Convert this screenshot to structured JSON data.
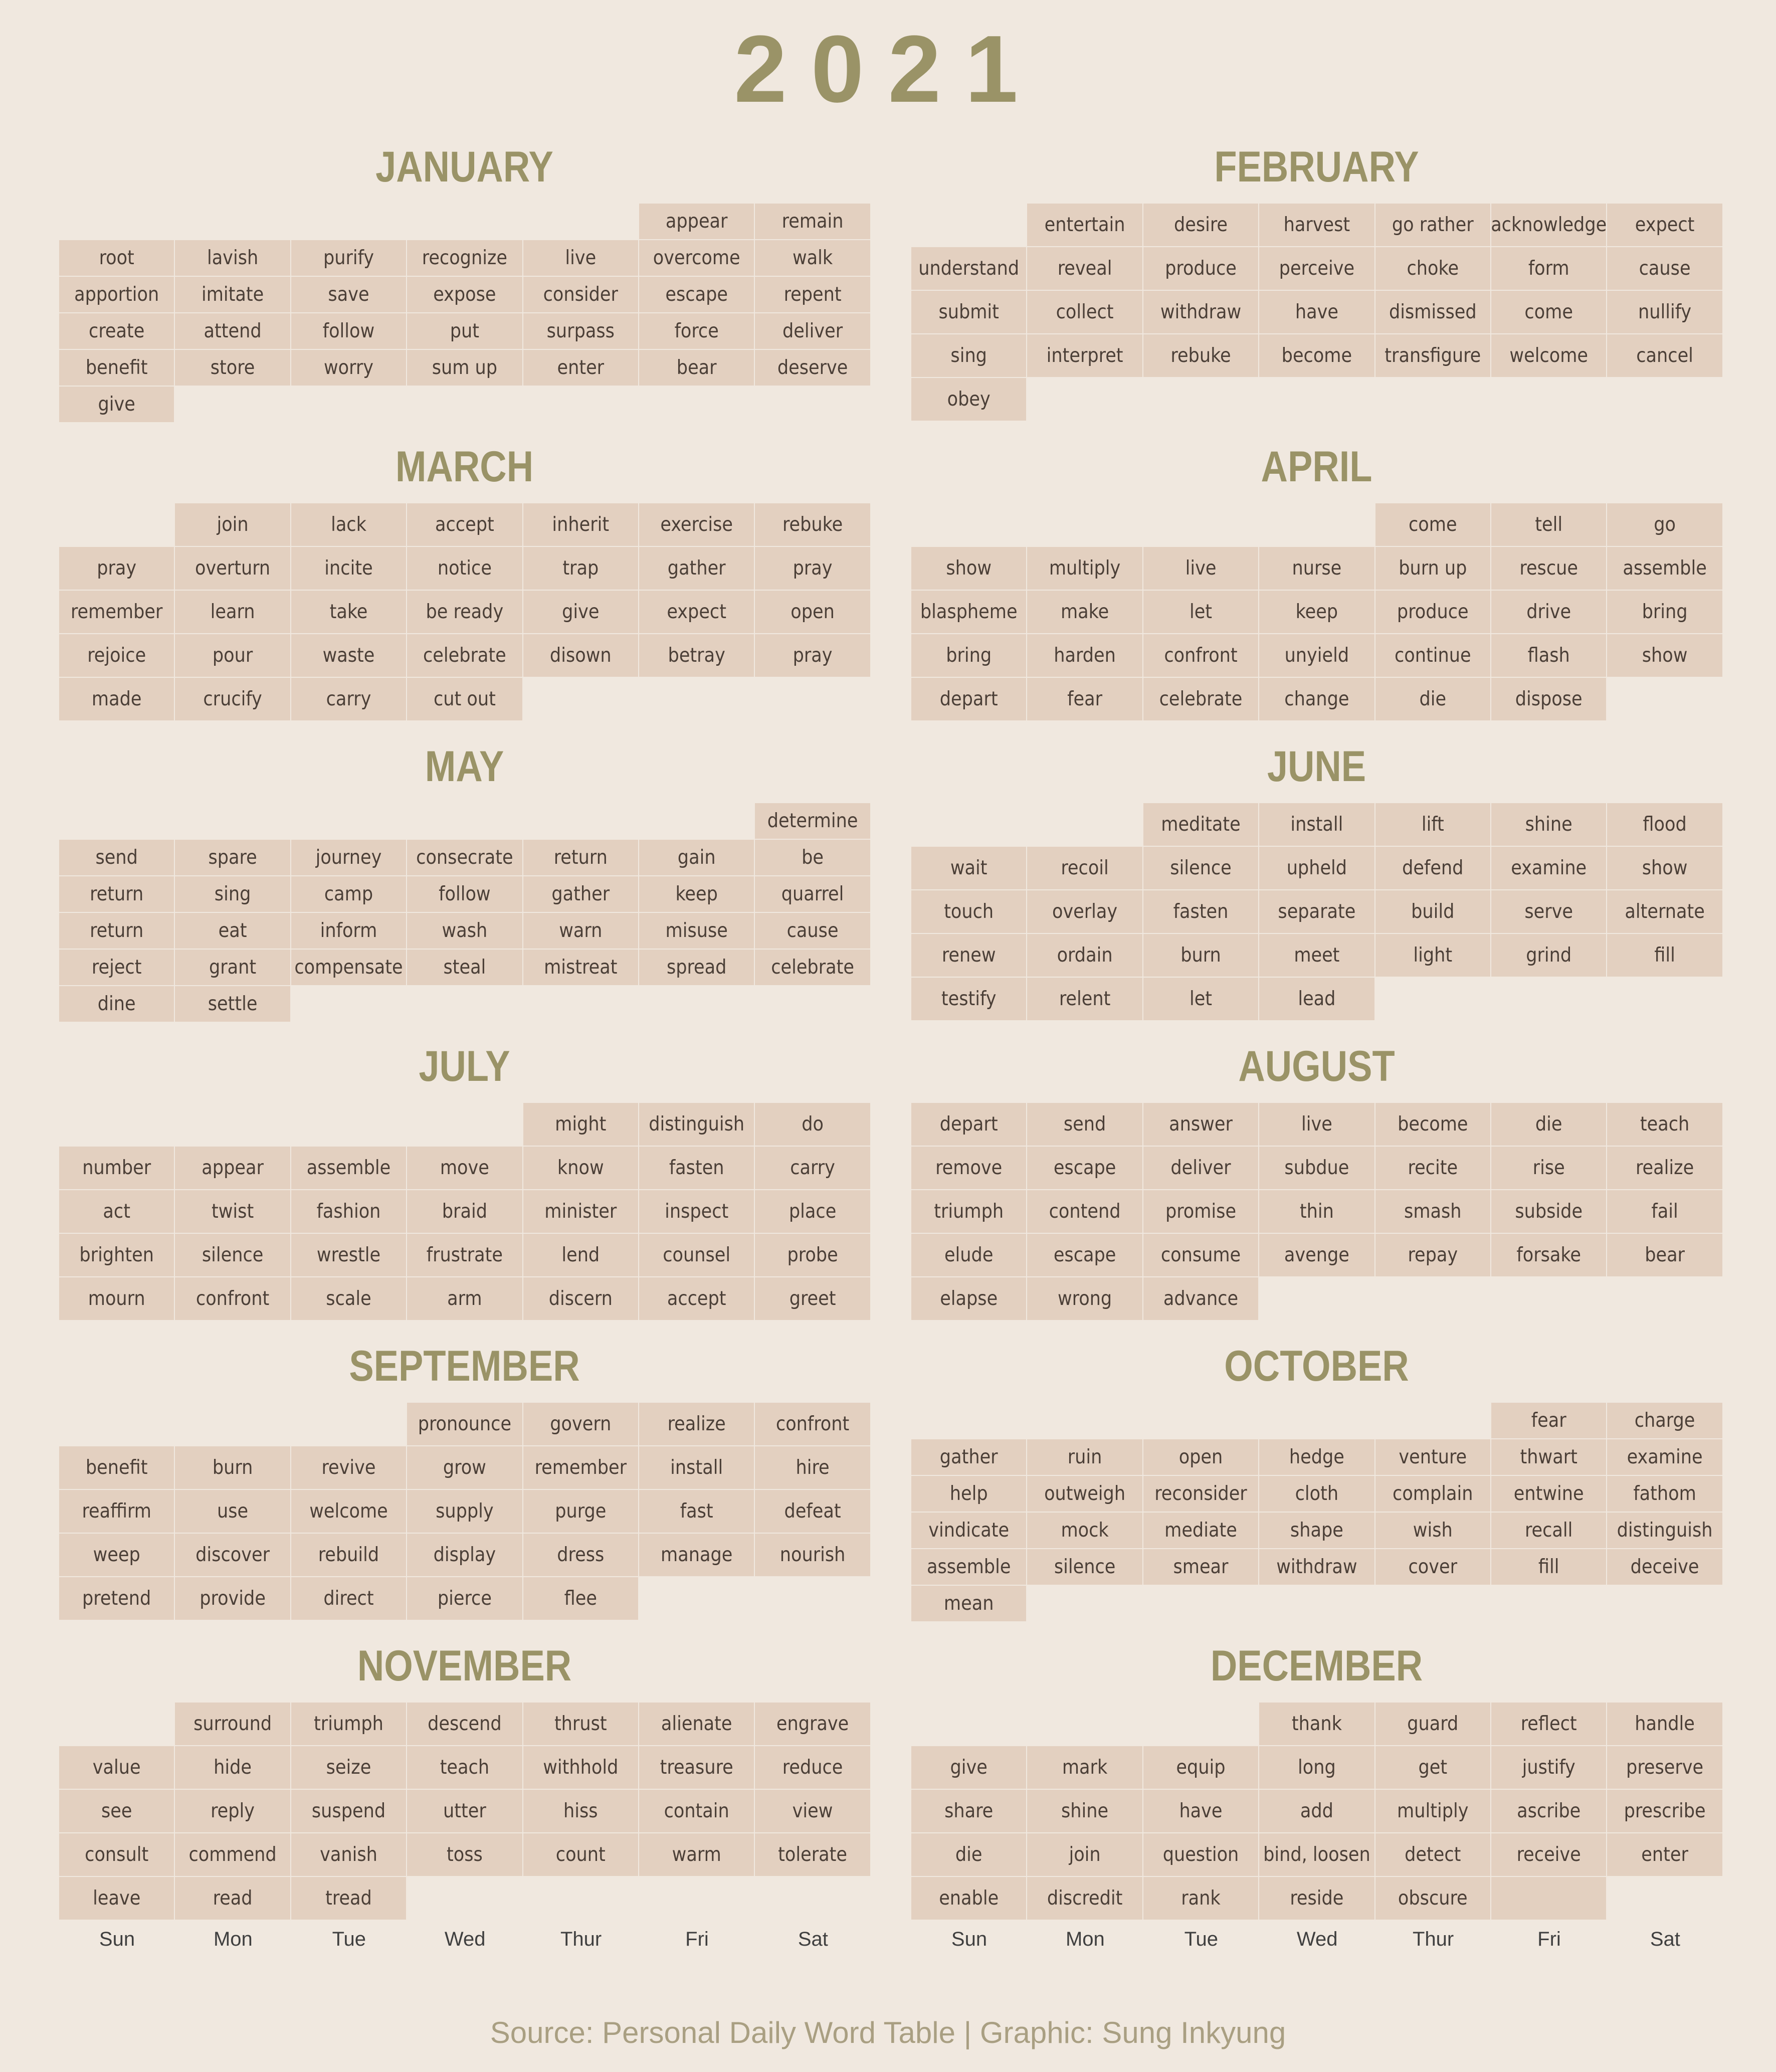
{
  "title": "2021",
  "footer": "Source: Personal Daily Word Table | Graphic: Sung Inkyung",
  "day_names": [
    "Sun",
    "Mon",
    "Tue",
    "Wed",
    "Thur",
    "Fri",
    "Sat"
  ],
  "colors": {
    "background": "#f0e8df",
    "cell": "#e3d0c0",
    "accent": "#9a9367",
    "text": "#4b3f37"
  },
  "months": [
    {
      "name": "JANUARY",
      "weeks": [
        [
          "",
          "",
          "",
          "",
          "",
          "appear",
          "remain"
        ],
        [
          "root",
          "lavish",
          "purify",
          "recognize",
          "live",
          "overcome",
          "walk"
        ],
        [
          "apportion",
          "imitate",
          "save",
          "expose",
          "consider",
          "escape",
          "repent"
        ],
        [
          "create",
          "attend",
          "follow",
          "put",
          "surpass",
          "force",
          "deliver"
        ],
        [
          "benefit",
          "store",
          "worry",
          "sum up",
          "enter",
          "bear",
          "deserve"
        ],
        [
          "give",
          "",
          "",
          "",
          "",
          "",
          ""
        ]
      ]
    },
    {
      "name": "FEBRUARY",
      "weeks": [
        [
          "",
          "entertain",
          "desire",
          "harvest",
          "go rather",
          "acknowledge",
          "expect"
        ],
        [
          "understand",
          "reveal",
          "produce",
          "perceive",
          "choke",
          "form",
          "cause"
        ],
        [
          "submit",
          "collect",
          "withdraw",
          "have",
          "dismissed",
          "come",
          "nullify"
        ],
        [
          "sing",
          "interpret",
          "rebuke",
          "become",
          "transfigure",
          "welcome",
          "cancel"
        ],
        [
          "obey",
          "",
          "",
          "",
          "",
          "",
          ""
        ]
      ]
    },
    {
      "name": "MARCH",
      "weeks": [
        [
          "",
          "join",
          "lack",
          "accept",
          "inherit",
          "exercise",
          "rebuke"
        ],
        [
          "pray",
          "overturn",
          "incite",
          "notice",
          "trap",
          "gather",
          "pray"
        ],
        [
          "remember",
          "learn",
          "take",
          "be ready",
          "give",
          "expect",
          "open"
        ],
        [
          "rejoice",
          "pour",
          "waste",
          "celebrate",
          "disown",
          "betray",
          "pray"
        ],
        [
          "made",
          "crucify",
          "carry",
          "cut out",
          "",
          "",
          ""
        ]
      ]
    },
    {
      "name": "APRIL",
      "weeks": [
        [
          "",
          "",
          "",
          "",
          "come",
          "tell",
          "go"
        ],
        [
          "show",
          "multiply",
          "live",
          "nurse",
          "burn up",
          "rescue",
          "assemble"
        ],
        [
          "blaspheme",
          "make",
          "let",
          "keep",
          "produce",
          "drive",
          "bring"
        ],
        [
          "bring",
          "harden",
          "confront",
          "unyield",
          "continue",
          "flash",
          "show"
        ],
        [
          "depart",
          "fear",
          "celebrate",
          "change",
          "die",
          "dispose",
          ""
        ]
      ]
    },
    {
      "name": "MAY",
      "weeks": [
        [
          "",
          "",
          "",
          "",
          "",
          "",
          "determine"
        ],
        [
          "send",
          "spare",
          "journey",
          "consecrate",
          "return",
          "gain",
          "be"
        ],
        [
          "return",
          "sing",
          "camp",
          "follow",
          "gather",
          "keep",
          "quarrel"
        ],
        [
          "return",
          "eat",
          "inform",
          "wash",
          "warn",
          "misuse",
          "cause"
        ],
        [
          "reject",
          "grant",
          "compensate",
          "steal",
          "mistreat",
          "spread",
          "celebrate"
        ],
        [
          "dine",
          "settle",
          "",
          "",
          "",
          "",
          ""
        ]
      ]
    },
    {
      "name": "JUNE",
      "weeks": [
        [
          "",
          "",
          "meditate",
          "install",
          "lift",
          "shine",
          "flood"
        ],
        [
          "wait",
          "recoil",
          "silence",
          "upheld",
          "defend",
          "examine",
          "show"
        ],
        [
          "touch",
          "overlay",
          "fasten",
          "separate",
          "build",
          "serve",
          "alternate"
        ],
        [
          "renew",
          "ordain",
          "burn",
          "meet",
          "light",
          "grind",
          "fill"
        ],
        [
          "testify",
          "relent",
          "let",
          "lead",
          "",
          "",
          ""
        ]
      ]
    },
    {
      "name": "JULY",
      "weeks": [
        [
          "",
          "",
          "",
          "",
          "might",
          "distinguish",
          "do"
        ],
        [
          "number",
          "appear",
          "assemble",
          "move",
          "know",
          "fasten",
          "carry"
        ],
        [
          "act",
          "twist",
          "fashion",
          "braid",
          "minister",
          "inspect",
          "place"
        ],
        [
          "brighten",
          "silence",
          "wrestle",
          "frustrate",
          "lend",
          "counsel",
          "probe"
        ],
        [
          "mourn",
          "confront",
          "scale",
          "arm",
          "discern",
          "accept",
          "greet"
        ]
      ]
    },
    {
      "name": "AUGUST",
      "weeks": [
        [
          "depart",
          "send",
          "answer",
          "live",
          "become",
          "die",
          "teach"
        ],
        [
          "remove",
          "escape",
          "deliver",
          "subdue",
          "recite",
          "rise",
          "realize"
        ],
        [
          "triumph",
          "contend",
          "promise",
          "thin",
          "smash",
          "subside",
          "fail"
        ],
        [
          "elude",
          "escape",
          "consume",
          "avenge",
          "repay",
          "forsake",
          "bear"
        ],
        [
          "elapse",
          "wrong",
          "advance",
          "",
          "",
          "",
          ""
        ]
      ]
    },
    {
      "name": "SEPTEMBER",
      "weeks": [
        [
          "",
          "",
          "",
          "pronounce",
          "govern",
          "realize",
          "confront"
        ],
        [
          "benefit",
          "burn",
          "revive",
          "grow",
          "remember",
          "install",
          "hire"
        ],
        [
          "reaffirm",
          "use",
          "welcome",
          "supply",
          "purge",
          "fast",
          "defeat"
        ],
        [
          "weep",
          "discover",
          "rebuild",
          "display",
          "dress",
          "manage",
          "nourish"
        ],
        [
          "pretend",
          "provide",
          "direct",
          "pierce",
          "flee",
          "",
          ""
        ]
      ]
    },
    {
      "name": "OCTOBER",
      "weeks": [
        [
          "",
          "",
          "",
          "",
          "",
          "fear",
          "charge"
        ],
        [
          "gather",
          "ruin",
          "open",
          "hedge",
          "venture",
          "thwart",
          "examine"
        ],
        [
          "help",
          "outweigh",
          "reconsider",
          "cloth",
          "complain",
          "entwine",
          "fathom"
        ],
        [
          "vindicate",
          "mock",
          "mediate",
          "shape",
          "wish",
          "recall",
          "distinguish"
        ],
        [
          "assemble",
          "silence",
          "smear",
          "withdraw",
          "cover",
          "fill",
          "deceive"
        ],
        [
          "mean",
          "",
          "",
          "",
          "",
          "",
          ""
        ]
      ]
    },
    {
      "name": "NOVEMBER",
      "weeks": [
        [
          "",
          "surround",
          "triumph",
          "descend",
          "thrust",
          "alienate",
          "engrave"
        ],
        [
          "value",
          "hide",
          "seize",
          "teach",
          "withhold",
          "treasure",
          "reduce"
        ],
        [
          "see",
          "reply",
          "suspend",
          "utter",
          "hiss",
          "contain",
          "view"
        ],
        [
          "consult",
          "commend",
          "vanish",
          "toss",
          "count",
          "warm",
          "tolerate"
        ],
        [
          "leave",
          "read",
          "tread",
          "",
          "",
          "",
          ""
        ]
      ]
    },
    {
      "name": "DECEMBER",
      "weeks": [
        [
          "",
          "",
          "",
          "thank",
          "guard",
          "reflect",
          "handle"
        ],
        [
          "give",
          "mark",
          "equip",
          "long",
          "get",
          "justify",
          "preserve"
        ],
        [
          "share",
          "shine",
          "have",
          "add",
          "multiply",
          "ascribe",
          "prescribe"
        ],
        [
          "die",
          "join",
          "question",
          "bind, loosen",
          "detect",
          "receive",
          "enter"
        ],
        [
          "enable",
          "discredit",
          "rank",
          "reside",
          "obscure",
          "",
          ""
        ]
      ]
    }
  ]
}
